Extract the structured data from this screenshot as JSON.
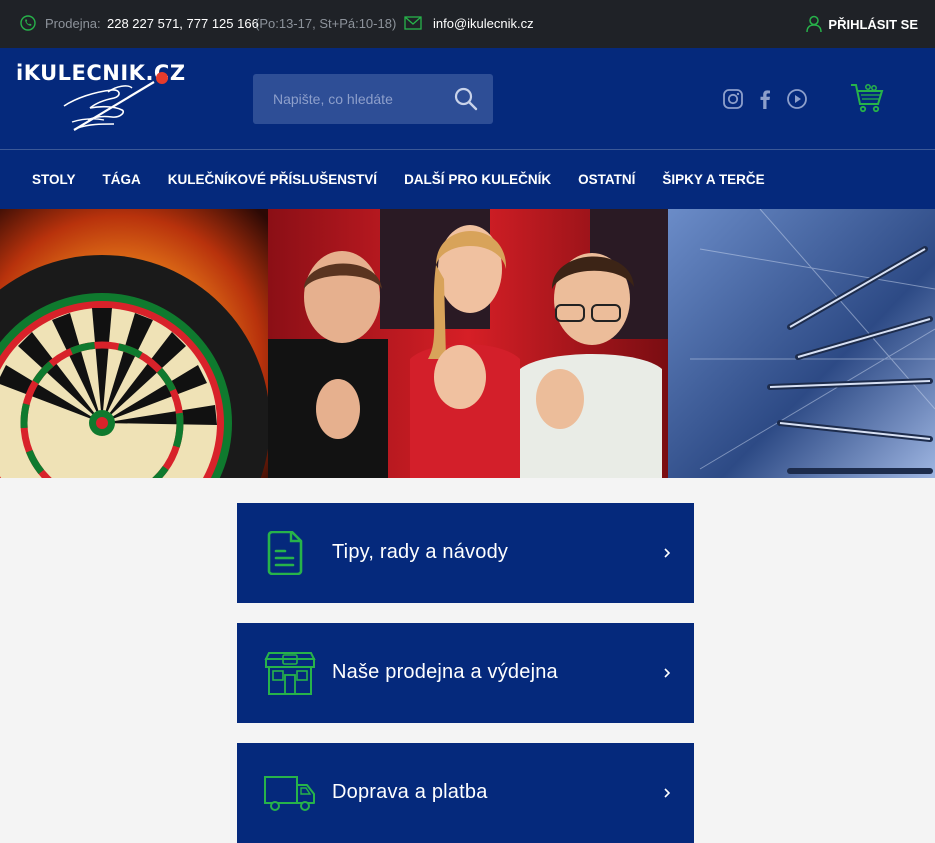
{
  "topbar": {
    "phone_label": "Prodejna:",
    "phone_numbers": "228 227 571, 777 125 166",
    "phone_hours": "(Po:13-17, St+Pá:10-18)",
    "email": "info@ikulecnik.cz",
    "login": "PŘIHLÁSIT SE"
  },
  "header": {
    "logo_text": "iKULECNIK.CZ",
    "search_placeholder": "Napište, co hledáte"
  },
  "nav": {
    "items": [
      "STOLY",
      "TÁGA",
      "KULEČNÍKOVÉ PŘÍSLUŠENSTVÍ",
      "DALŠÍ PRO KULEČNÍK",
      "OSTATNÍ",
      "ŠIPKY A TERČE"
    ]
  },
  "cards": [
    {
      "label": "Tipy, rady a návody",
      "icon": "document-icon"
    },
    {
      "label": "Naše prodejna a výdejna",
      "icon": "store-icon"
    },
    {
      "label": "Doprava a platba",
      "icon": "truck-icon"
    }
  ],
  "colors": {
    "topbar": "#1f2227",
    "header": "#05297c",
    "accent_green": "#27b34a",
    "search_bg": "#2e4e96"
  }
}
